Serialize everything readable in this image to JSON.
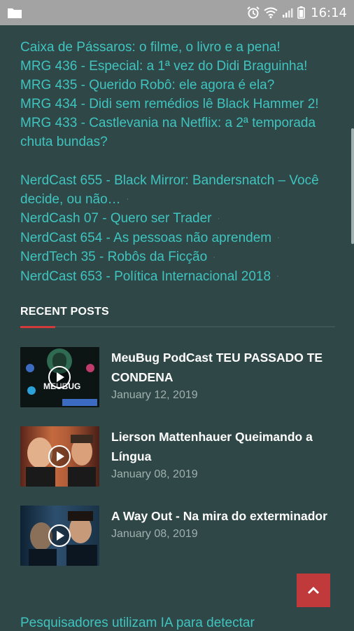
{
  "status_bar": {
    "time": "16:14",
    "icons": [
      "folder-icon",
      "alarm-icon",
      "wifi-icon",
      "signal-icon",
      "battery-icon"
    ]
  },
  "links_group_1": [
    "Caixa de Pássaros: o filme, o livro e a pena!",
    "MRG 436 - Especial: a 1ª vez do Didi Braguinha!",
    "MRG 435 - Querido Robô: ele agora é ela?",
    "MRG 434 - Didi sem remédios lê Black Hammer 2!",
    "MRG 433 - Castlevania na Netflix: a 2ª temporada chuta bundas?"
  ],
  "links_group_2": [
    "NerdCast 655 - Black Mirror: Bandersnatch – Você decide, ou não…",
    "NerdCash 07 - Quero ser Trader",
    "NerdCast 654 - As pessoas não aprendem",
    "NerdTech 35 - Robôs da Ficção",
    "NerdCast 653 - Política Internacional 2018"
  ],
  "recent_posts": {
    "title": "RECENT POSTS",
    "items": [
      {
        "title": "MeuBug PodCast TEU PASSADO TE CONDENA",
        "date": "January 12, 2019",
        "thumb_text": "MEUBUG"
      },
      {
        "title": "Lierson Mattenhauer Queimando a Língua",
        "date": "January 08, 2019"
      },
      {
        "title": "A Way Out - Na mira do exterminador",
        "date": "January 08, 2019"
      }
    ]
  },
  "bottom_link": "Pesquisadores utilizam IA para detectar",
  "colors": {
    "background": "#2f4746",
    "link": "#3fc4c0",
    "accent": "#d33a3a",
    "status_bar": "#a3a3a3"
  }
}
